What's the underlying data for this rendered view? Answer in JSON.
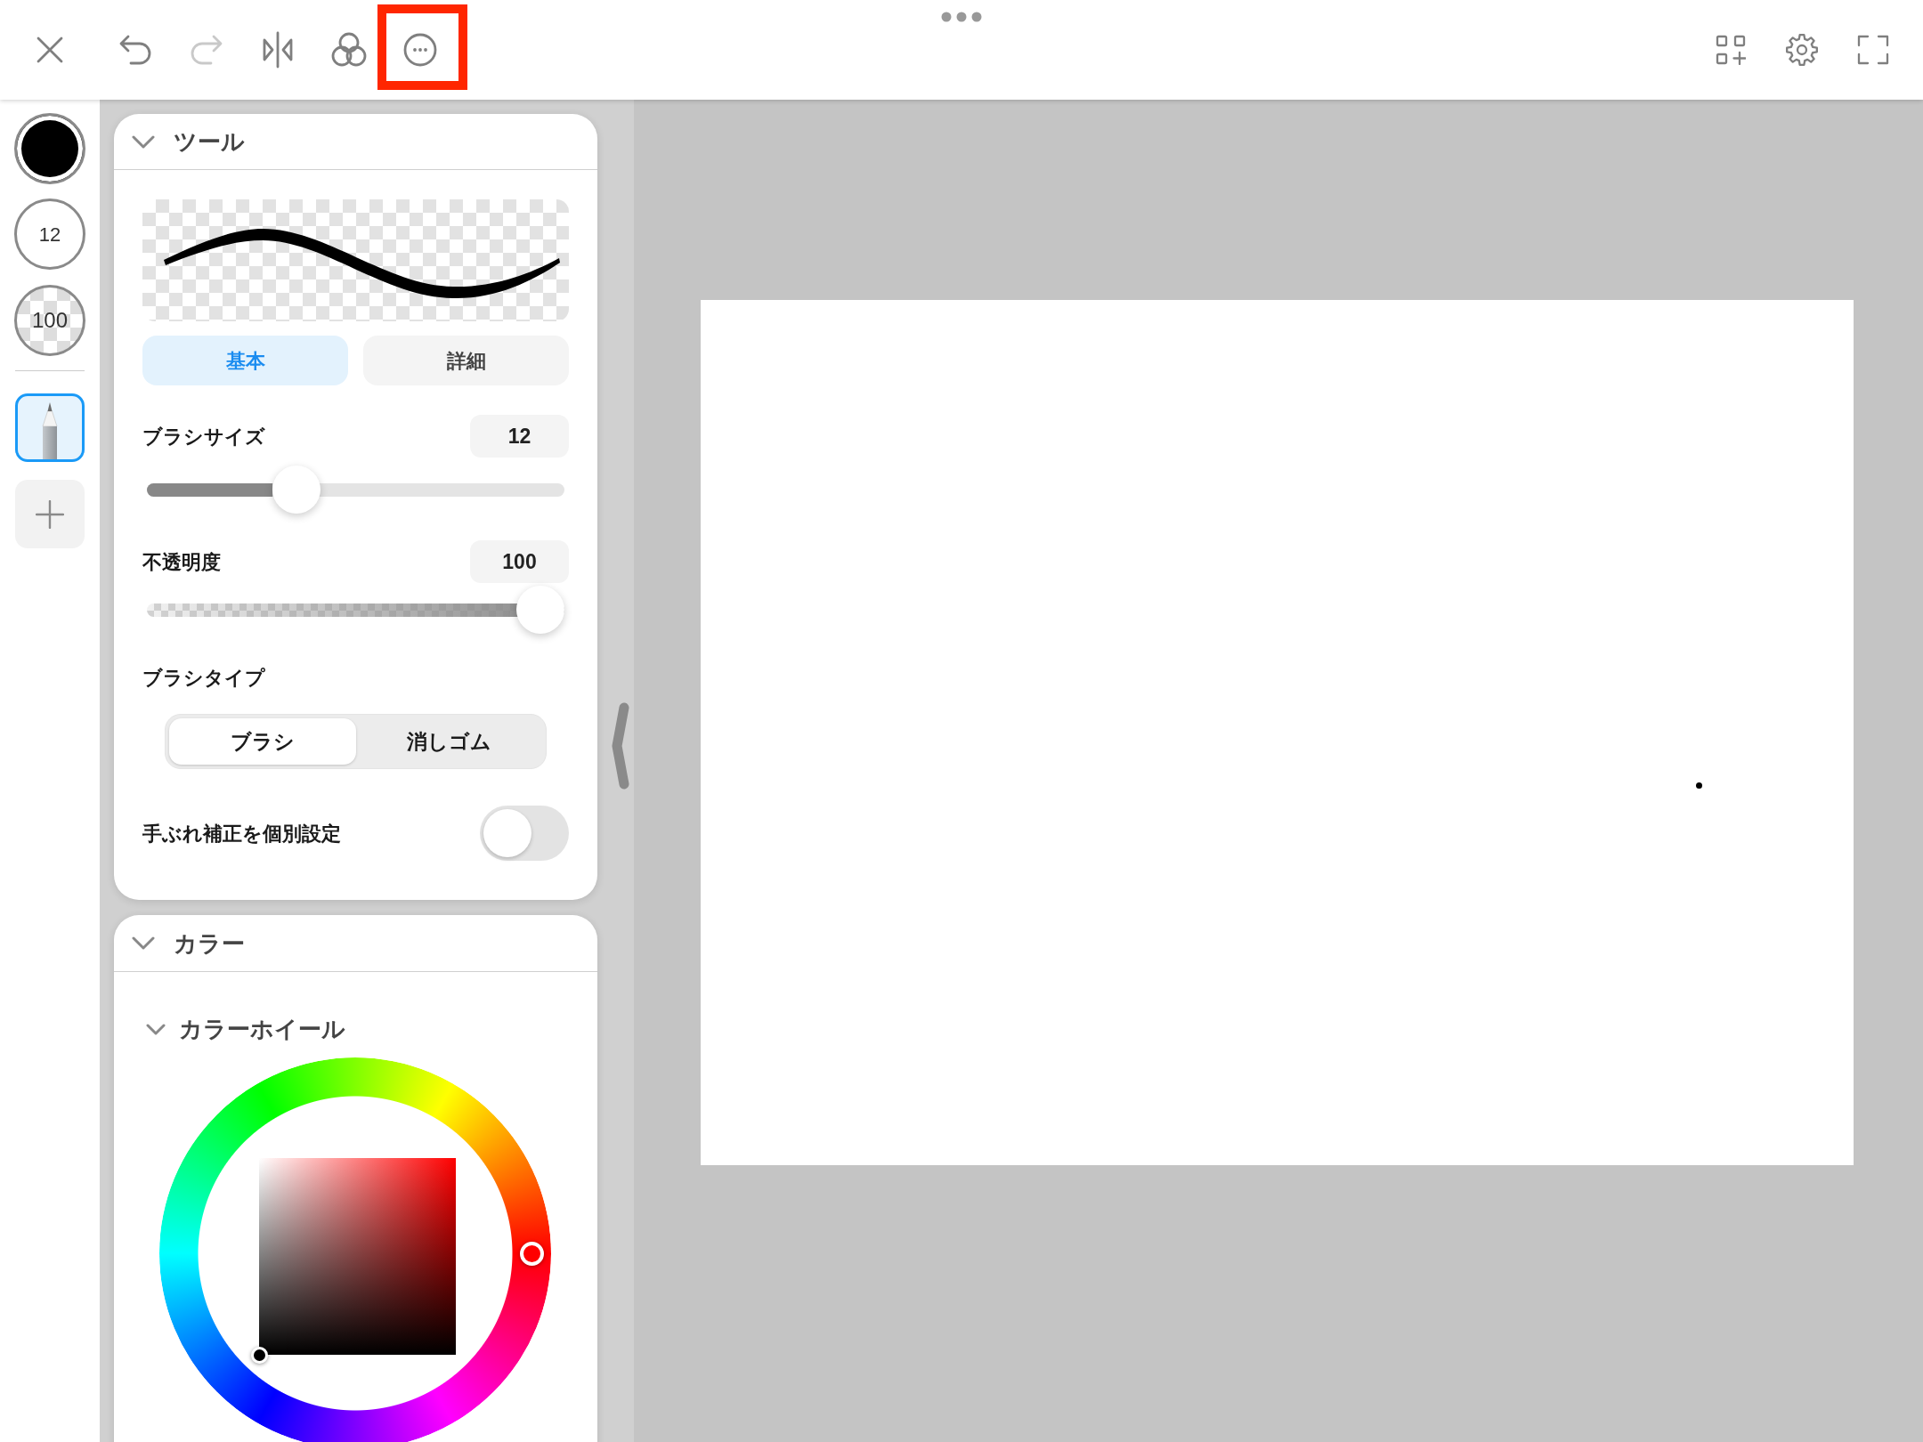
{
  "toolbar": {
    "left": [
      {
        "kind": "close",
        "disabled": false,
        "highlighted": false
      },
      {
        "kind": "undo",
        "disabled": false,
        "highlighted": false
      },
      {
        "kind": "redo",
        "disabled": true,
        "highlighted": false
      },
      {
        "kind": "mirror",
        "disabled": false,
        "highlighted": false
      },
      {
        "kind": "blend",
        "disabled": false,
        "highlighted": false
      },
      {
        "kind": "more",
        "disabled": false,
        "highlighted": true
      }
    ],
    "right": [
      {
        "kind": "grid-add"
      },
      {
        "kind": "settings"
      },
      {
        "kind": "fullscreen"
      }
    ]
  },
  "sidebar": {
    "color_swatch": {
      "color": "#000000"
    },
    "brush_size": "12",
    "opacity": "100",
    "tools": [
      {
        "kind": "pencil",
        "selected": true
      }
    ]
  },
  "tool_panel": {
    "title": "ツール",
    "expanded": true,
    "tabs": [
      {
        "label": "基本",
        "selected": true
      },
      {
        "label": "詳細",
        "selected": false
      }
    ],
    "brush_size": {
      "label": "ブラシサイズ",
      "value": "12",
      "level": 0.34
    },
    "opacity": {
      "label": "不透明度",
      "value": "100",
      "level": 1
    },
    "brush_type": {
      "label": "ブラシタイプ",
      "options": [
        {
          "label": "ブラシ",
          "selected": true
        },
        {
          "label": "消しゴム",
          "selected": false
        }
      ]
    },
    "stabilizer": {
      "label": "手ぶれ補正を個別設定",
      "on": false
    }
  },
  "color_panel": {
    "title": "カラー",
    "expanded": true,
    "color_wheel": {
      "title": "カラーホイール",
      "expanded": true,
      "hue_handle": {
        "color": "#ff0000"
      },
      "color_handle": {
        "color": "#000000"
      }
    }
  }
}
